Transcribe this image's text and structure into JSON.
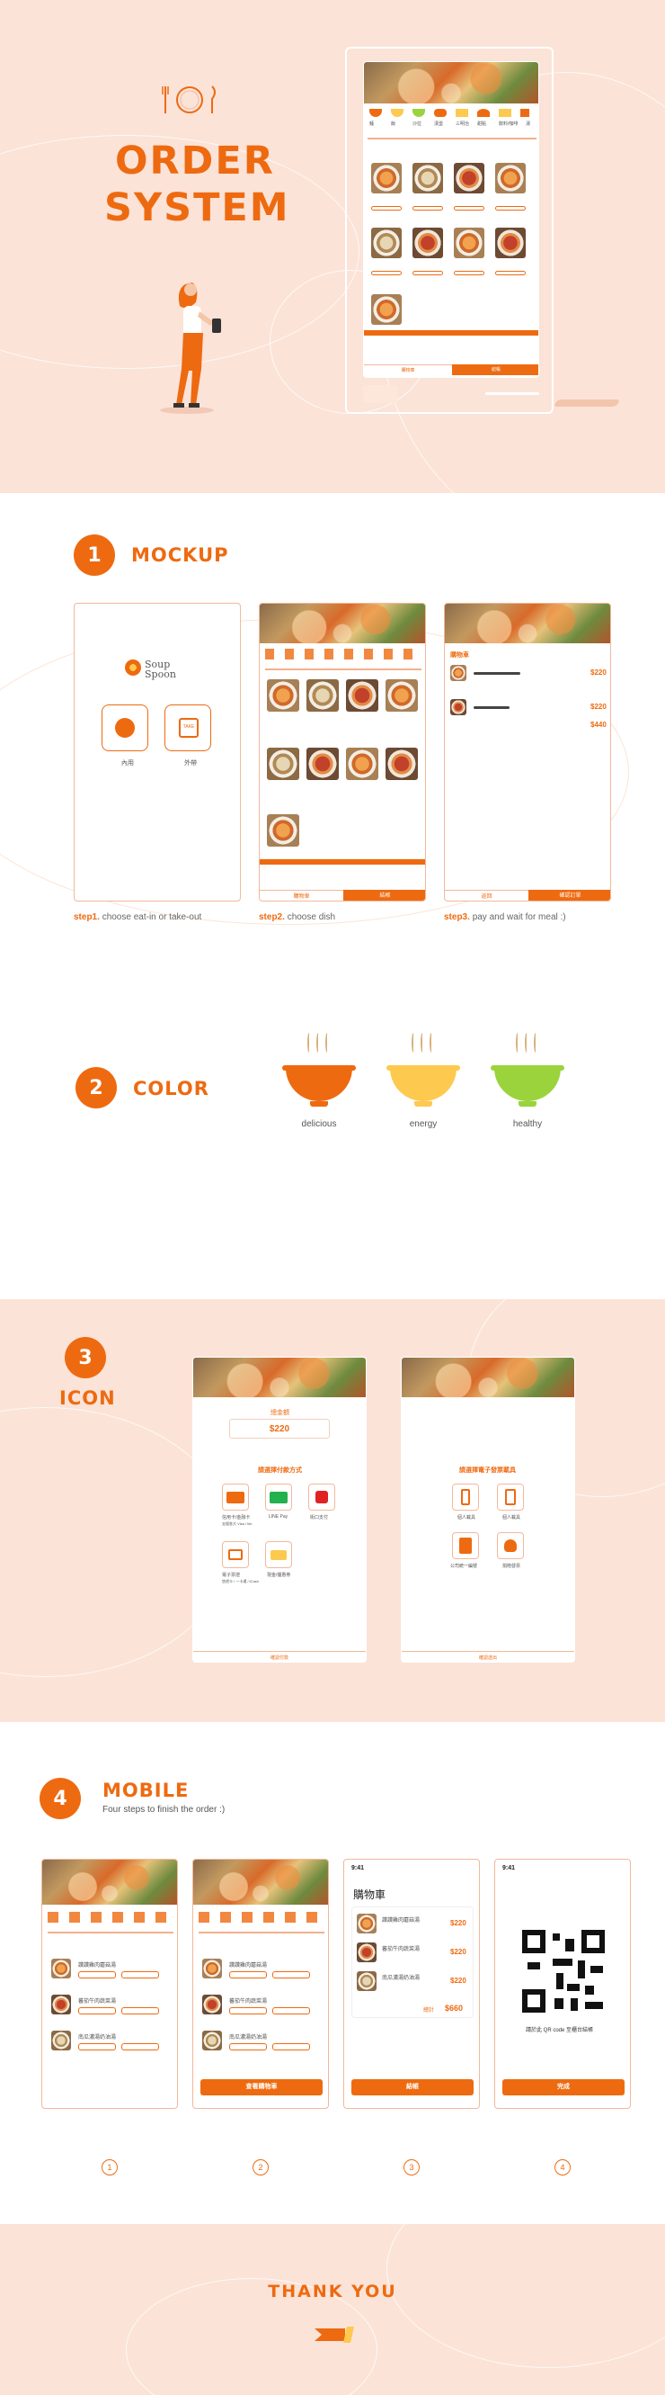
{
  "hero": {
    "title_line1": "ORDER",
    "title_line2": "SYSTEM",
    "mockup": {
      "cats": [
        "麵",
        "飯",
        "沙拉",
        "漢堡",
        "三明治",
        "甜點",
        "飲料/咖啡",
        "湯"
      ],
      "cart_label": "購物車",
      "order_label": "結帳"
    }
  },
  "section1": {
    "number": "1",
    "label": "MOCKUP",
    "brand": "Soup Spoon",
    "dine_in": "內用",
    "take_out": "外帶",
    "take_out_tag": "TAKE",
    "step1_key": "step1.",
    "step1_text": "choose eat-in or take-out",
    "step2_key": "step2.",
    "step2_text": "choose dish",
    "step3_key": "step3.",
    "step3_text": "pay and wait for meal :)",
    "screen2_btn_left": "購物車",
    "screen2_btn_right": "結帳",
    "screen3_header": "購物車",
    "screen3_btn_left": "返回",
    "screen3_btn_right": "確認訂單",
    "prices": [
      "$220",
      "$220",
      "$440"
    ]
  },
  "section2": {
    "number": "2",
    "label": "COLOR",
    "colors": [
      {
        "name": "delicious",
        "hex": "#ee6a10"
      },
      {
        "name": "energy",
        "hex": "#fdc94f"
      },
      {
        "name": "healthy",
        "hex": "#9bd33c"
      }
    ]
  },
  "section3": {
    "number": "3",
    "label": "ICON",
    "pay_title": "總金額",
    "pay_amount": "$220",
    "pay_method_title": "請選擇付款方式",
    "methods": [
      "信用卡/金融卡",
      "LINE Pay",
      "街口支付",
      "電子票證",
      "現金/優惠券"
    ],
    "methods_sub": [
      "支援各大 Visa / Mc",
      "",
      "",
      "悠遊卡 / 一卡通 / iCash",
      ""
    ],
    "pay_footer": "確認付款",
    "invoice_title": "請選擇電子發票載具",
    "invoices": [
      "個人載具",
      "個人載具",
      "公司統一編號",
      "捐贈發票"
    ],
    "invoice_footer": "確認送出"
  },
  "section4": {
    "number": "4",
    "label": "MOBILE",
    "subtitle": "Four steps to finish the order :)",
    "time": "9:41",
    "cart_title": "購物車",
    "items": [
      "讚讚雞肉蘑菇湯",
      "蕃茄牛肉蔬菜湯",
      "南瓜濃湯奶油湯"
    ],
    "item_prices": [
      "$220",
      "$220",
      "$220"
    ],
    "total_label": "總計",
    "total": "$660",
    "checkout": "結帳",
    "view_cart": "查看購物車",
    "qr_caption": "請於此 QR code 至櫃台結帳",
    "done": "完成",
    "steps": [
      "1",
      "2",
      "3",
      "4"
    ]
  },
  "footer": {
    "thanks": "THANK YOU"
  },
  "palette": {
    "accent": "#ee6a10",
    "peach": "#fbe3d8",
    "border": "#f3b89a"
  }
}
